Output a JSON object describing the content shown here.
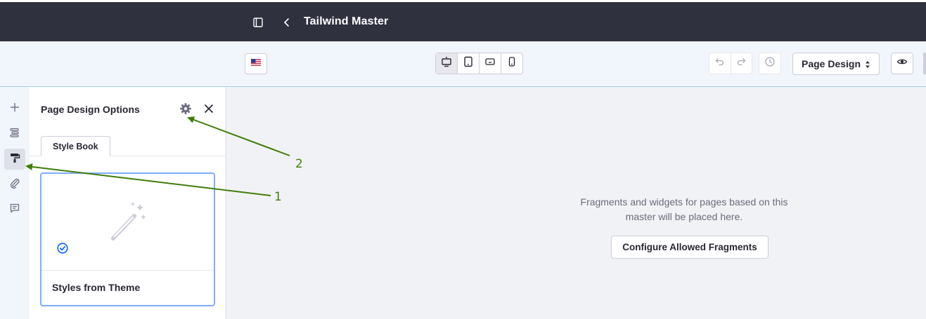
{
  "header": {
    "title": "Tailwind Master",
    "sidebar_toggle_icon": "sidebar-toggle-icon",
    "back_icon": "chevron-left-icon"
  },
  "toolbar": {
    "language_icon": "us-flag-icon",
    "devices": [
      {
        "name": "desktop",
        "icon": "monitor-icon",
        "active": true
      },
      {
        "name": "tablet",
        "icon": "tablet-icon",
        "active": false
      },
      {
        "name": "landscape-phone",
        "icon": "phone-landscape-icon",
        "active": false
      },
      {
        "name": "portrait-phone",
        "icon": "phone-portrait-icon",
        "active": false
      }
    ],
    "undo_icon": "undo-icon",
    "redo_icon": "redo-icon",
    "history_icon": "history-icon",
    "mode_select": {
      "value": "Page Design"
    },
    "preview_icon": "eye-icon"
  },
  "rail": {
    "items": [
      {
        "name": "add",
        "icon": "plus-icon",
        "active": false
      },
      {
        "name": "browser",
        "icon": "page-structure-icon",
        "active": false
      },
      {
        "name": "page-design",
        "icon": "paint-roller-icon",
        "active": true
      },
      {
        "name": "mapping",
        "icon": "paperclip-icon",
        "active": false
      },
      {
        "name": "comments",
        "icon": "comment-icon",
        "active": false
      }
    ]
  },
  "panel": {
    "title": "Page Design Options",
    "tabs": [
      {
        "label": "Style Book",
        "active": true
      }
    ],
    "cards": [
      {
        "name": "Styles from Theme",
        "selected": true
      }
    ]
  },
  "canvas": {
    "message": "Fragments and widgets for pages based on this master will be placed here.",
    "configure_button": "Configure Allowed Fragments"
  },
  "annotations": [
    {
      "label": "1"
    },
    {
      "label": "2"
    }
  ],
  "colors": {
    "topbar_bg": "#30313f",
    "toolbar_bg": "#f1f5fc",
    "canvas_bg": "#f1f2f5",
    "accent": "#0b5fff",
    "annotation": "#3f7d0a"
  }
}
